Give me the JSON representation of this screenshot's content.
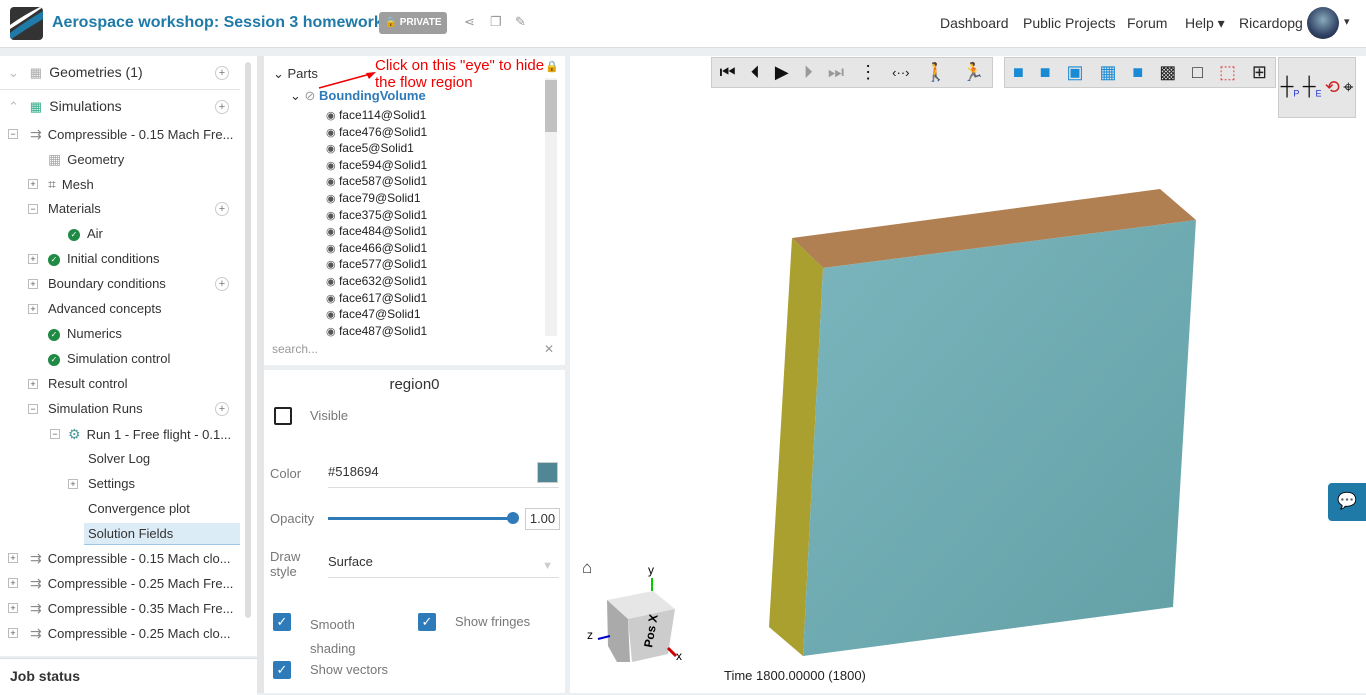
{
  "header": {
    "title": "Aerospace workshop: Session 3 homework",
    "private_badge": "PRIVATE",
    "nav": [
      "Dashboard",
      "Public Projects",
      "Forum",
      "Help",
      "Ricardopg"
    ]
  },
  "sidebar": {
    "geometries": "Geometries (1)",
    "simulations": "Simulations",
    "tree": [
      {
        "label": "Compressible - 0.15 Mach Fre...",
        "level": 0,
        "exp": "−",
        "icon": "sim"
      },
      {
        "label": "Geometry",
        "level": 1,
        "exp": "",
        "icon": "geo"
      },
      {
        "label": "Mesh",
        "level": 1,
        "exp": "+",
        "icon": "mesh"
      },
      {
        "label": "Materials",
        "level": 1,
        "exp": "−",
        "plus": true
      },
      {
        "label": "Air",
        "level": 2,
        "exp": "",
        "icon": "check"
      },
      {
        "label": "Initial conditions",
        "level": 1,
        "exp": "+",
        "icon": "check"
      },
      {
        "label": "Boundary conditions",
        "level": 1,
        "exp": "+",
        "plus": true
      },
      {
        "label": "Advanced concepts",
        "level": 1,
        "exp": "+"
      },
      {
        "label": "Numerics",
        "level": 1,
        "exp": "",
        "icon": "check"
      },
      {
        "label": "Simulation control",
        "level": 1,
        "exp": "",
        "icon": "check"
      },
      {
        "label": "Result control",
        "level": 1,
        "exp": "+"
      },
      {
        "label": "Simulation Runs",
        "level": 1,
        "exp": "−",
        "plus": true
      },
      {
        "label": "Run 1 - Free flight - 0.1...",
        "level": 2,
        "exp": "−",
        "icon": "gear"
      },
      {
        "label": "Solver Log",
        "level": 3,
        "exp": ""
      },
      {
        "label": "Settings",
        "level": 3,
        "exp": "+"
      },
      {
        "label": "Convergence plot",
        "level": 3,
        "exp": ""
      },
      {
        "label": "Solution Fields",
        "level": 3,
        "exp": "",
        "selected": true
      },
      {
        "label": "Compressible - 0.15 Mach clo...",
        "level": 0,
        "exp": "+",
        "icon": "sim"
      },
      {
        "label": "Compressible - 0.25 Mach Fre...",
        "level": 0,
        "exp": "+",
        "icon": "sim"
      },
      {
        "label": "Compressible - 0.35 Mach Fre...",
        "level": 0,
        "exp": "+",
        "icon": "sim"
      },
      {
        "label": "Compressible - 0.25 Mach clo...",
        "level": 0,
        "exp": "+",
        "icon": "sim"
      }
    ],
    "job_status": "Job status"
  },
  "parts": {
    "root": "Parts",
    "volume": "BoundingVolume",
    "annotation": "Click on this \"eye\" to hide the flow region",
    "search_placeholder": "search...",
    "faces": [
      "face114@Solid1",
      "face476@Solid1",
      "face5@Solid1",
      "face594@Solid1",
      "face587@Solid1",
      "face79@Solid1",
      "face375@Solid1",
      "face484@Solid1",
      "face466@Solid1",
      "face577@Solid1",
      "face632@Solid1",
      "face617@Solid1",
      "face47@Solid1",
      "face487@Solid1"
    ]
  },
  "props": {
    "title": "region0",
    "visible": "Visible",
    "color_label": "Color",
    "color_value": "#518694",
    "opacity_label": "Opacity",
    "opacity_value": "1.00",
    "opacity": 1.0,
    "draw_label": "Draw style",
    "draw_value": "Surface",
    "smooth": "Smooth shading",
    "fringes": "Show fringes",
    "vectors": "Show vectors"
  },
  "viewer": {
    "time": "Time 1800.00000 (1800)",
    "cube_label": "Pos X",
    "axes": [
      "x",
      "y",
      "z"
    ],
    "colors": {
      "top": "#b08052",
      "side": "#a9a030",
      "front": "#6fa9b0"
    }
  }
}
